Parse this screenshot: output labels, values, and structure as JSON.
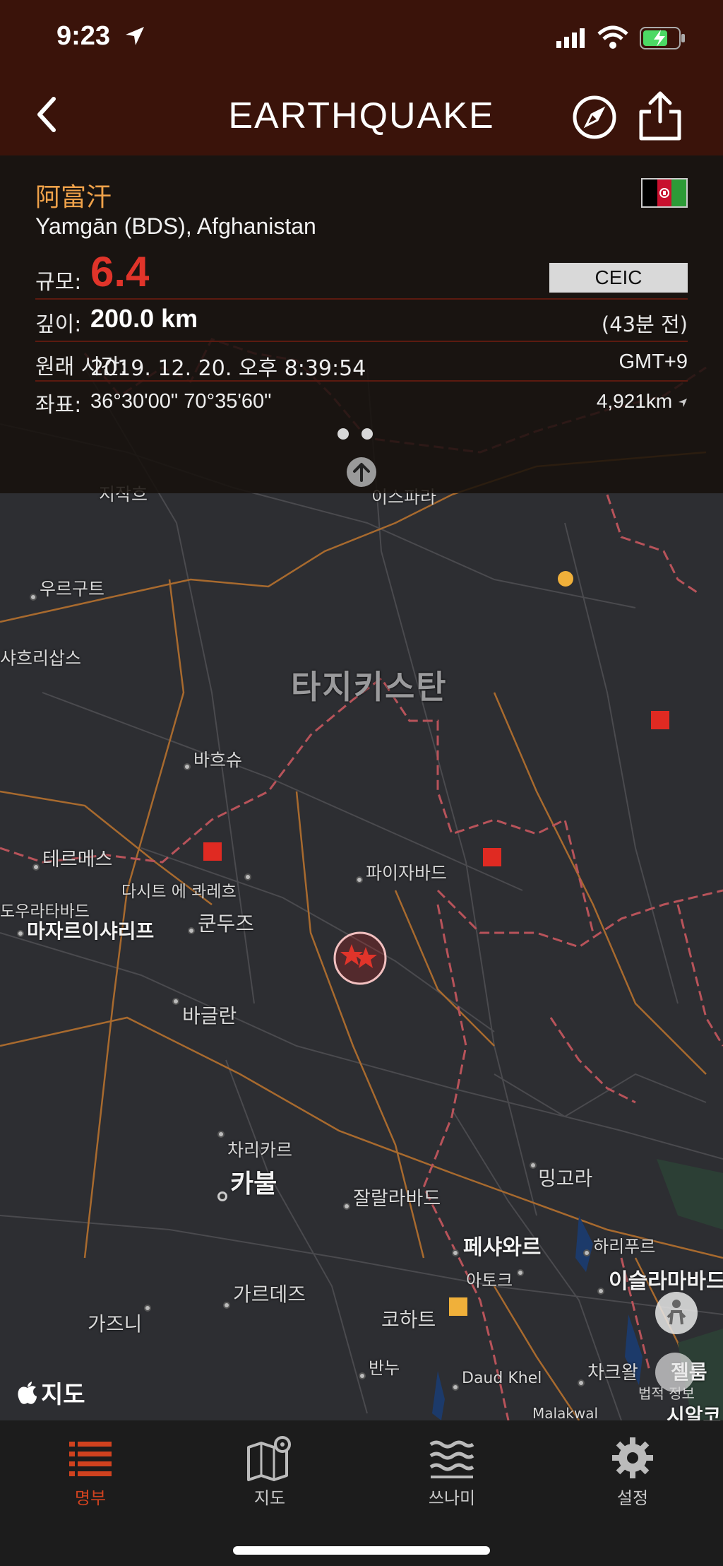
{
  "status_bar": {
    "time": "9:23"
  },
  "nav": {
    "title": "EARTHQUAKE"
  },
  "quake": {
    "place_native": "阿富汗",
    "place_name": "Yamgān (BDS), Afghanistan",
    "magnitude_label": "규모:",
    "magnitude": "6.4",
    "source": "CEIC",
    "depth_label": "깊이:",
    "depth": "200.0 km",
    "time_ago": "(43분 전)",
    "origin_label": "원래 시간:",
    "origin_time": "2019. 12. 20. 오후 8:39:54",
    "timezone": "GMT+9",
    "coord_label": "좌표:",
    "coords": "36°30'00\"  70°35'60\"",
    "distance": "4,921km"
  },
  "map": {
    "country_label": "타지키스탄",
    "cities": [
      {
        "name": "우르구트"
      },
      {
        "name": "샤흐리삽스"
      },
      {
        "name": "바흐슈"
      },
      {
        "name": "테르메스"
      },
      {
        "name": "다시트 에 콰레흐"
      },
      {
        "name": "도우라타바드"
      },
      {
        "name": "마자르이샤리프"
      },
      {
        "name": "쿤두즈"
      },
      {
        "name": "파이자바드"
      },
      {
        "name": "바글란"
      },
      {
        "name": "차리카르"
      },
      {
        "name": "카불"
      },
      {
        "name": "잘랄라바드"
      },
      {
        "name": "밍고라"
      },
      {
        "name": "페샤와르"
      },
      {
        "name": "하리푸르"
      },
      {
        "name": "아토크"
      },
      {
        "name": "이슬라마바드"
      },
      {
        "name": "가르데즈"
      },
      {
        "name": "가즈니"
      },
      {
        "name": "코하트"
      },
      {
        "name": "반누"
      },
      {
        "name": "Daud Khel"
      },
      {
        "name": "차크왈"
      },
      {
        "name": "Malakwal"
      },
      {
        "name": "젤룸"
      },
      {
        "name": "시알코"
      },
      {
        "name": "이스파라"
      },
      {
        "name": "지작흐"
      }
    ],
    "attribution": "지도",
    "legal": "법적 정보"
  },
  "tabs": [
    {
      "label": "명부"
    },
    {
      "label": "지도"
    },
    {
      "label": "쓰나미"
    },
    {
      "label": "설정"
    }
  ],
  "colors": {
    "header": "#3a130a",
    "accent": "#d0421f",
    "magnitude": "#e0342a",
    "place": "#f0a24a"
  }
}
